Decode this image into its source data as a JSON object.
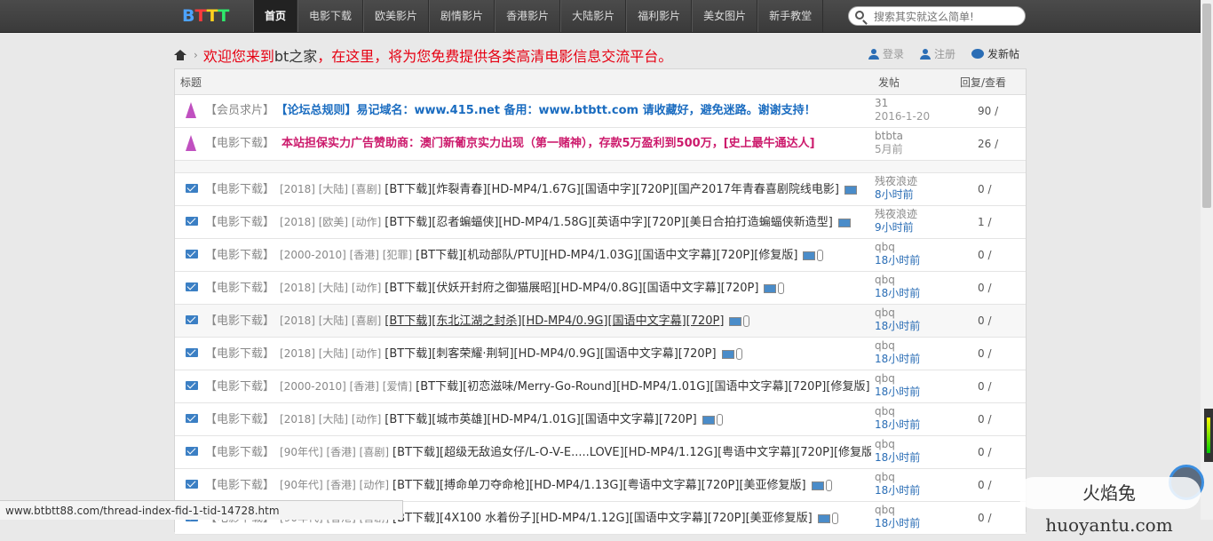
{
  "logo": {
    "letters": [
      "B",
      "T",
      "T",
      "T"
    ],
    "colors": [
      "#4da3ff",
      "#ff3b3b",
      "#ffd21e",
      "#2ee86b"
    ]
  },
  "nav": {
    "items": [
      "首页",
      "电影下载",
      "欧美影片",
      "剧情影片",
      "香港影片",
      "大陆影片",
      "福利影片",
      "美女图片",
      "新手教堂"
    ]
  },
  "search": {
    "placeholder": "搜索其实就这么简单!"
  },
  "welcome": {
    "part1": "欢迎您来到",
    "bt": "bt之家",
    "part2": "，在这里，将为您免费提供各类高清电影信息交流平台。"
  },
  "user_links": {
    "login": "登录",
    "register": "注册",
    "post": "发新帖"
  },
  "table_header": {
    "title": "标题",
    "author": "发帖",
    "stats": "回复/查看"
  },
  "sticky": [
    {
      "forum": "【会员求片】",
      "title": "【论坛总规则】易记域名：www.415.net 备用：www.btbtt.com 请收藏好，避免迷路。谢谢支持！",
      "author": "31",
      "time": "2016-1-20",
      "stats": "90 /"
    },
    {
      "forum": "【电影下载】",
      "title": "本站担保实力广告赞助商：澳门新葡京实力出现（第一赌神），存款5万盈利到500万，[史上最牛通达人]",
      "author": "btbta",
      "time": "5月前",
      "stats": "26 /"
    }
  ],
  "threads": [
    {
      "forum": "【电影下载】",
      "tags": "[2018] [大陆] [喜剧]",
      "title": "[BT下载][炸裂青春][HD-MP4/1.67G][国语中字][720P][国产2017年青春喜剧院线电影]",
      "author": "残夜浪迹",
      "time": "8小时前",
      "stats": "0 /"
    },
    {
      "forum": "【电影下载】",
      "tags": "[2018] [欧美] [动作]",
      "title": "[BT下载][忍者蝙蝠侠][HD-MP4/1.58G][英语中字][720P][美日合拍打造蝙蝠侠新造型]",
      "author": "残夜浪迹",
      "time": "9小时前",
      "stats": "1 /"
    },
    {
      "forum": "【电影下载】",
      "tags": "[2000-2010] [香港] [犯罪]",
      "title": "[BT下载][机动部队/PTU][HD-MP4/1.03G][国语中文字幕][720P][修复版]",
      "author": "qbq",
      "time": "18小时前",
      "stats": "0 /"
    },
    {
      "forum": "【电影下载】",
      "tags": "[2018] [大陆] [动作]",
      "title": "[BT下载][伏妖开封府之御猫展昭][HD-MP4/0.8G][国语中文字幕][720P]",
      "author": "qbq",
      "time": "18小时前",
      "stats": "0 /"
    },
    {
      "forum": "【电影下载】",
      "tags": "[2018] [大陆] [喜剧]",
      "title": "[BT下载][东北江湖之封杀][HD-MP4/0.9G][国语中文字幕][720P]",
      "author": "qbq",
      "time": "18小时前",
      "stats": "0 /"
    },
    {
      "forum": "【电影下载】",
      "tags": "[2018] [大陆] [动作]",
      "title": "[BT下载][刺客荣耀·荆轲][HD-MP4/0.9G][国语中文字幕][720P]",
      "author": "qbq",
      "time": "18小时前",
      "stats": "0 /"
    },
    {
      "forum": "【电影下载】",
      "tags": "[2000-2010] [香港] [爱情]",
      "title": "[BT下载][初恋滋味/Merry-Go-Round][HD-MP4/1.01G][国语中文字幕][720P][修复版]",
      "author": "qbq",
      "time": "18小时前",
      "stats": "0 /"
    },
    {
      "forum": "【电影下载】",
      "tags": "[2018] [大陆] [动作]",
      "title": "[BT下载][城市英雄][HD-MP4/1.01G][国语中文字幕][720P]",
      "author": "qbq",
      "time": "18小时前",
      "stats": "0 /"
    },
    {
      "forum": "【电影下载】",
      "tags": "[90年代] [香港] [喜剧]",
      "title": "[BT下载][超级无敌追女仔/L-O-V-E.....LOVE][HD-MP4/1.12G][粤语中文字幕][720P][修复版]",
      "author": "qbq",
      "time": "18小时前",
      "stats": "0 /"
    },
    {
      "forum": "【电影下载】",
      "tags": "[90年代] [香港] [动作]",
      "title": "[BT下载][搏命单刀夺命枪][HD-MP4/1.13G][粤语中文字幕][720P][美亚修复版]",
      "author": "qbq",
      "time": "18小时前",
      "stats": "0 /"
    },
    {
      "forum": "【电影下载】",
      "tags": "[90年代] [香港] [喜剧]",
      "title": "[BT下载][4X100 水着份子][HD-MP4/1.12G][国语中文字幕][720P][美亚修复版]",
      "author": "qbq",
      "time": "18小时前",
      "stats": "0 /"
    }
  ],
  "status_url": "www.btbtt88.com/thread-index-fid-1-tid-14728.htm",
  "watermark": "火焰兔 huoyantu.com"
}
